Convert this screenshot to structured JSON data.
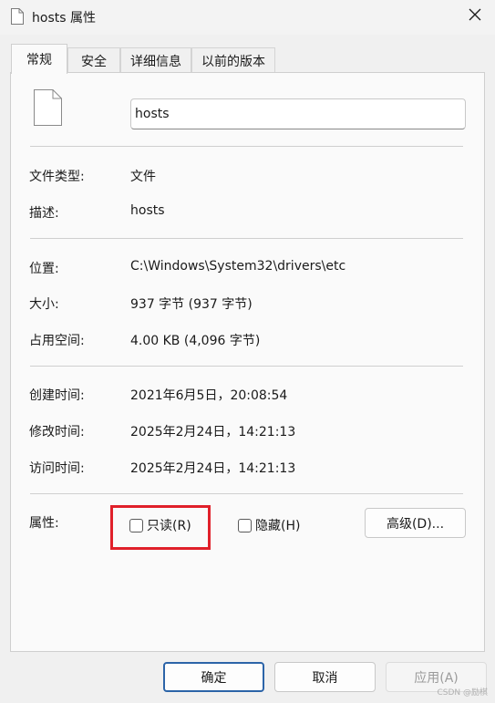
{
  "window": {
    "title": "hosts 属性"
  },
  "tabs": [
    {
      "label": "常规"
    },
    {
      "label": "安全"
    },
    {
      "label": "详细信息"
    },
    {
      "label": "以前的版本"
    }
  ],
  "general": {
    "file_name": "hosts",
    "type_label": "文件类型:",
    "type_value": "文件",
    "desc_label": "描述:",
    "desc_value": "hosts",
    "location_label": "位置:",
    "location_value": "C:\\Windows\\System32\\drivers\\etc",
    "size_label": "大小:",
    "size_value": "937 字节 (937 字节)",
    "disk_size_label": "占用空间:",
    "disk_size_value": "4.00 KB (4,096 字节)",
    "created_label": "创建时间:",
    "created_value": "2021年6月5日，20:08:54",
    "modified_label": "修改时间:",
    "modified_value": "2025年2月24日，14:21:13",
    "accessed_label": "访问时间:",
    "accessed_value": "2025年2月24日，14:21:13",
    "attributes_label": "属性:",
    "readonly_label": "只读(R)",
    "hidden_label": "隐藏(H)",
    "advanced_label": "高级(D)..."
  },
  "footer": {
    "ok_label": "确定",
    "cancel_label": "取消",
    "apply_label": "应用(A)"
  },
  "watermark": "CSDN @励棋",
  "colors": {
    "highlight_box": "#e0202a",
    "default_button_border": "#2c64a8"
  }
}
